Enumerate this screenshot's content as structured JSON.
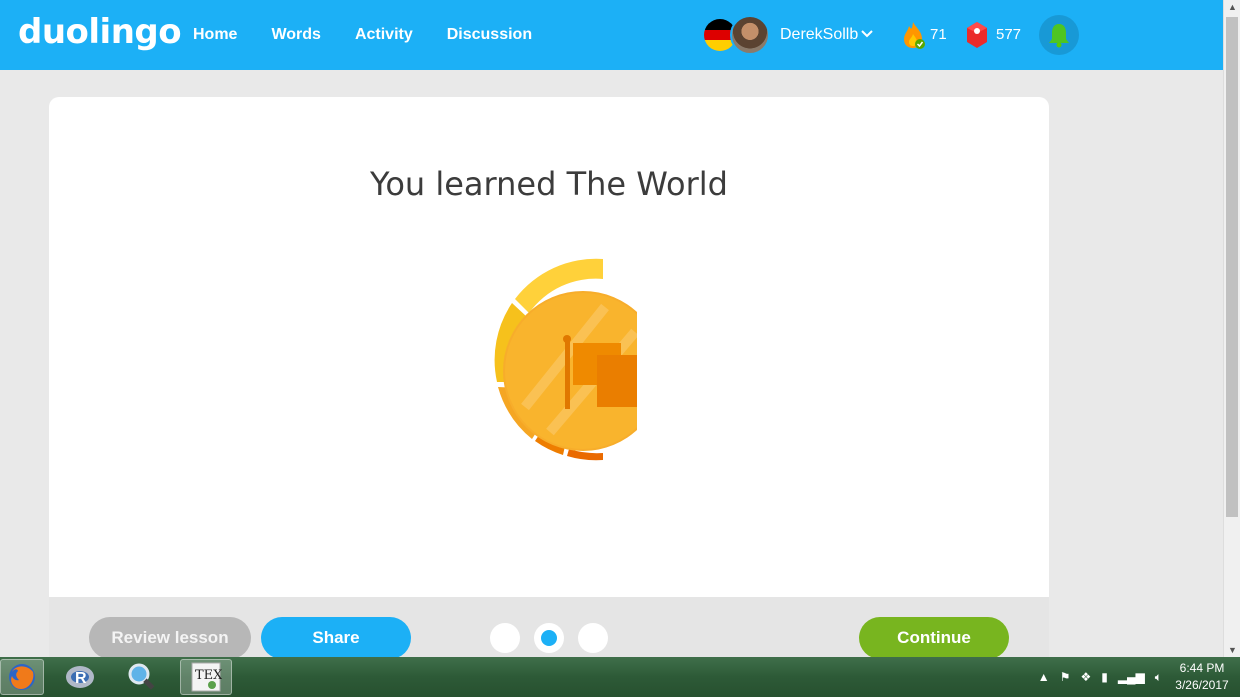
{
  "header": {
    "logo": "duolingo",
    "nav": [
      "Home",
      "Words",
      "Activity",
      "Discussion"
    ],
    "username": "DerekSollb",
    "streak": "71",
    "gems": "577"
  },
  "card": {
    "title": "You learned The World"
  },
  "footer": {
    "review_label": "Review lesson",
    "share_label": "Share",
    "continue_label": "Continue",
    "pagination_active": 2,
    "pagination_count": 3
  },
  "taskbar": {
    "apps": [
      "firefox-icon",
      "r-icon",
      "search-app-icon",
      "tex-icon"
    ],
    "tex_label": "TEX",
    "r_label": "R",
    "time": "6:44 PM",
    "date": "3/26/2017"
  },
  "colors": {
    "brand_blue": "#1cb0f6",
    "continue_green": "#78b51f",
    "badge_gold": "#f9b42d",
    "badge_orange": "#ef8a00"
  }
}
